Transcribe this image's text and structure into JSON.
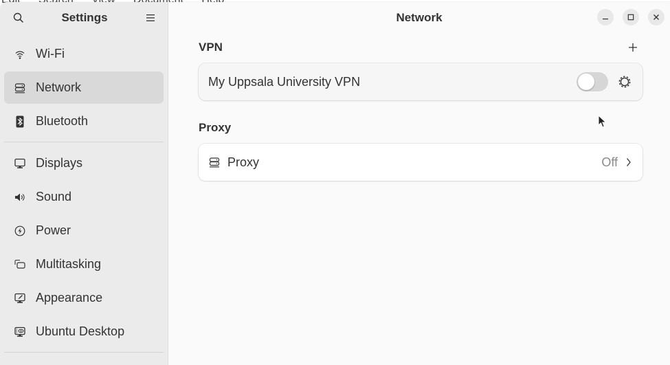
{
  "background_menubar": [
    "Edit",
    "Search",
    "View",
    "Document",
    "Help"
  ],
  "sidebar": {
    "title": "Settings",
    "search_icon": "search-icon",
    "menu_icon": "hamburger-menu-icon",
    "groups": [
      [
        {
          "label": "Wi-Fi",
          "icon": "wifi-icon",
          "active": false
        },
        {
          "label": "Network",
          "icon": "network-icon",
          "active": true
        },
        {
          "label": "Bluetooth",
          "icon": "bluetooth-icon",
          "active": false
        }
      ],
      [
        {
          "label": "Displays",
          "icon": "display-icon",
          "active": false
        },
        {
          "label": "Sound",
          "icon": "speaker-icon",
          "active": false
        },
        {
          "label": "Power",
          "icon": "power-icon",
          "active": false
        },
        {
          "label": "Multitasking",
          "icon": "multitasking-icon",
          "active": false
        },
        {
          "label": "Appearance",
          "icon": "appearance-icon",
          "active": false
        },
        {
          "label": "Ubuntu Desktop",
          "icon": "ubuntu-desktop-icon",
          "active": false
        }
      ]
    ]
  },
  "main": {
    "title": "Network",
    "window_controls": [
      "minimize",
      "maximize",
      "close"
    ],
    "vpn": {
      "section_title": "VPN",
      "add_icon": "plus-icon",
      "connection": {
        "name": "My Uppsala University VPN",
        "enabled": false,
        "settings_icon": "gear-icon"
      }
    },
    "proxy": {
      "section_title": "Proxy",
      "row": {
        "label": "Proxy",
        "value": "Off",
        "icon": "network-icon"
      }
    }
  },
  "colors": {
    "sidebar_bg": "#ebebeb",
    "sidebar_active": "#d9d9d9",
    "main_bg": "#fafafa",
    "card_bg": "#ffffff",
    "toggle_off": "#d6d6d6",
    "text": "#333333",
    "muted_text": "#8a8a8a"
  }
}
